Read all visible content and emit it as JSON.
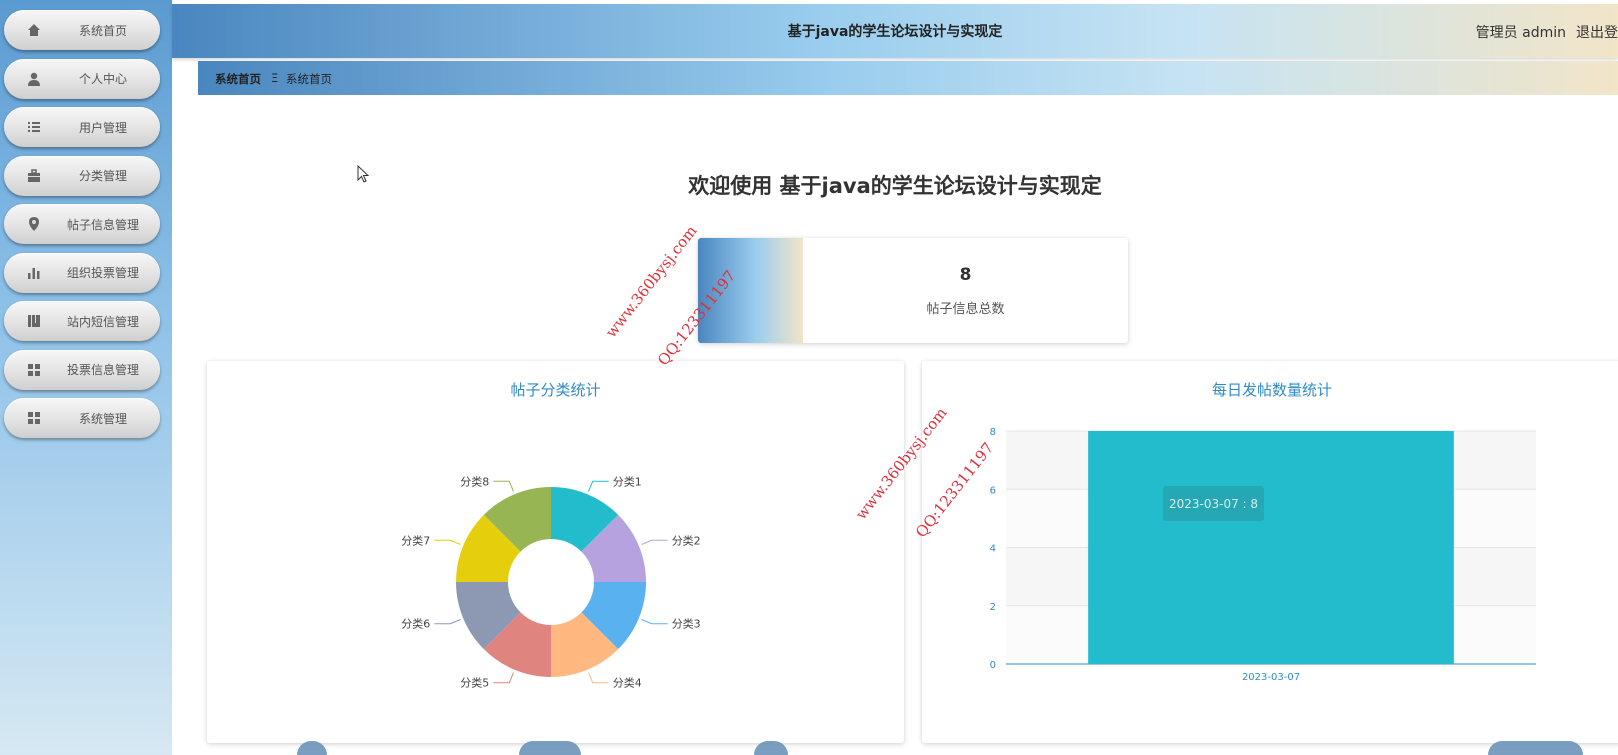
{
  "app": {
    "title": "基于java的学生论坛设计与实现定",
    "user": "管理员 admin",
    "logout": "退出登"
  },
  "sidebar": {
    "items": [
      {
        "label": "系统首页",
        "icon": "home-icon"
      },
      {
        "label": "个人中心",
        "icon": "user-icon"
      },
      {
        "label": "用户管理",
        "icon": "list-icon"
      },
      {
        "label": "分类管理",
        "icon": "briefcase-icon"
      },
      {
        "label": "帖子信息管理",
        "icon": "pin-icon"
      },
      {
        "label": "组织投票管理",
        "icon": "bar-chart-icon"
      },
      {
        "label": "站内短信管理",
        "icon": "book-icon"
      },
      {
        "label": "投票信息管理",
        "icon": "grid-icon"
      },
      {
        "label": "系统管理",
        "icon": "grid-icon"
      }
    ]
  },
  "breadcrumb": {
    "root": "系统首页",
    "separator": "Ξ",
    "current": "系统首页"
  },
  "main": {
    "welcome": "欢迎使用 基于java的学生论坛设计与实现定",
    "stat": {
      "value": "8",
      "label": "帖子信息总数"
    },
    "pie_title": "帖子分类统计",
    "bar_title": "每日发帖数量统计",
    "tooltip": "2023-03-07 : 8"
  },
  "watermarks": {
    "site": "www.360bysj.com",
    "qq": "QQ:123311197"
  },
  "colors": {
    "accent": "#2f8bc6",
    "bar": "#22bccd"
  },
  "chart_data": [
    {
      "type": "pie",
      "title": "帖子分类统计",
      "donut": true,
      "categories": [
        "分类1",
        "分类2",
        "分类3",
        "分类4",
        "分类5",
        "分类6",
        "分类7",
        "分类8"
      ],
      "values": [
        1,
        1,
        1,
        1,
        1,
        1,
        1,
        1
      ],
      "colors": [
        "#22bccd",
        "#b6a2de",
        "#5ab1ef",
        "#ffb980",
        "#e0847f",
        "#8d98b3",
        "#e5cf0d",
        "#97b552"
      ]
    },
    {
      "type": "bar",
      "title": "每日发帖数量统计",
      "categories": [
        "2023-03-07"
      ],
      "values": [
        8
      ],
      "ylim": [
        0,
        8
      ],
      "yticks": [
        "0",
        "2",
        "4",
        "6",
        "8"
      ],
      "grid": true
    }
  ]
}
